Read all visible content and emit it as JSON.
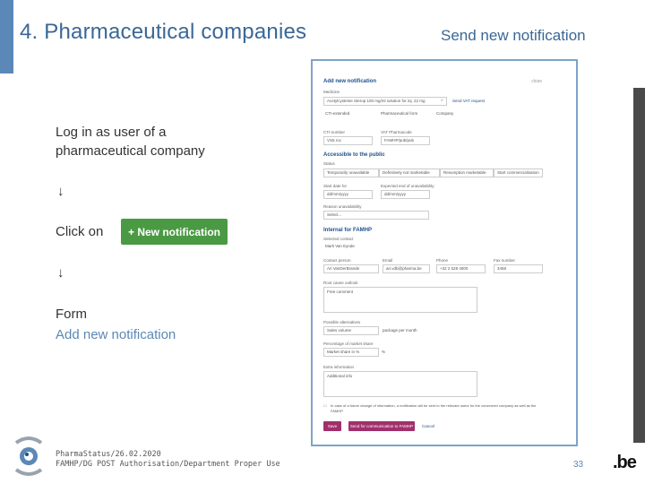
{
  "slide": {
    "title": "4. Pharmaceutical companies",
    "subtitle": "Send new notification",
    "step1": "Log in as user of a pharmaceutical company",
    "arrow": "↓",
    "click_label": "Click on",
    "new_notification_button": "+ New notification",
    "form_label": "Form",
    "form_link": "Add new notification",
    "footer_line1": "PharmaStatus/26.02.2020",
    "footer_line2": "FAMHP/DG POST Authorisation/Department Proper Use",
    "page_number": "33",
    "be_logo": ".be"
  },
  "colors": {
    "accent": "#5b88b6",
    "button_green": "#4a9a44",
    "form_heading": "#1d4f8c",
    "form_button": "#a0306a"
  },
  "screenshot": {
    "title": "Add new notification",
    "close": "close",
    "medicine_label": "Medicine",
    "medicine_value": "Acetylcysteine Sterop 100 mg/ml solution for inj. 22 mg",
    "search_link": "Send VAT request",
    "col_a": "CTI-extended",
    "col_b": "Pharmaceutical form",
    "col_c": "Company",
    "cti_label": "CTI-number",
    "cti_value": "VS5 roc",
    "vat_label": "VAT Pharmacode",
    "vat_value": "FAMHP/pub/pub",
    "public_section": "Accessible to the public",
    "status_label": "Status",
    "status_options": [
      "Temporarily unavailable",
      "Definitively not marketable",
      "Resumption marketable",
      "Start commercialisation"
    ],
    "start_label": "Start date for",
    "start_value": "dd/mm/yyyy",
    "end_label": "Expected end of unavailability",
    "end_value": "dd/mm/yyyy",
    "reason_label": "Reason unavailability",
    "reason_value": "Select...",
    "internal_section": "Internal for FAMHP",
    "contact_label": "Selected contact",
    "contact_value": "Mark Van Eynde",
    "person_label": "Contact person",
    "person_value": "Ari VanDerBrande",
    "email_label": "Email",
    "email_value": "ari.vdb@pharma.be",
    "phone_label": "Phone",
    "phone_value": "+32 2 528 4000",
    "fax_label": "Fax number",
    "fax_value": "3458",
    "remarks_label": "Root cause outlook",
    "remarks_value": "Free comment",
    "alt_label": "Possible alternatives",
    "alt_value": "Sales volume",
    "alt_unit": "package per month",
    "pct_label": "Percentage of market share",
    "pct_value": "Market share in %",
    "pct_unit": "%",
    "extra_label": "Extra information",
    "extra_value": "Additional info",
    "confirm_text": "In case of a future change of information, a notification will be sent to the relevant users for the concerned company as well as the FAMHP.",
    "btn_save": "Save",
    "btn_save_notify": "Send for communication to FAMHP",
    "btn_cancel": "Cancel"
  }
}
